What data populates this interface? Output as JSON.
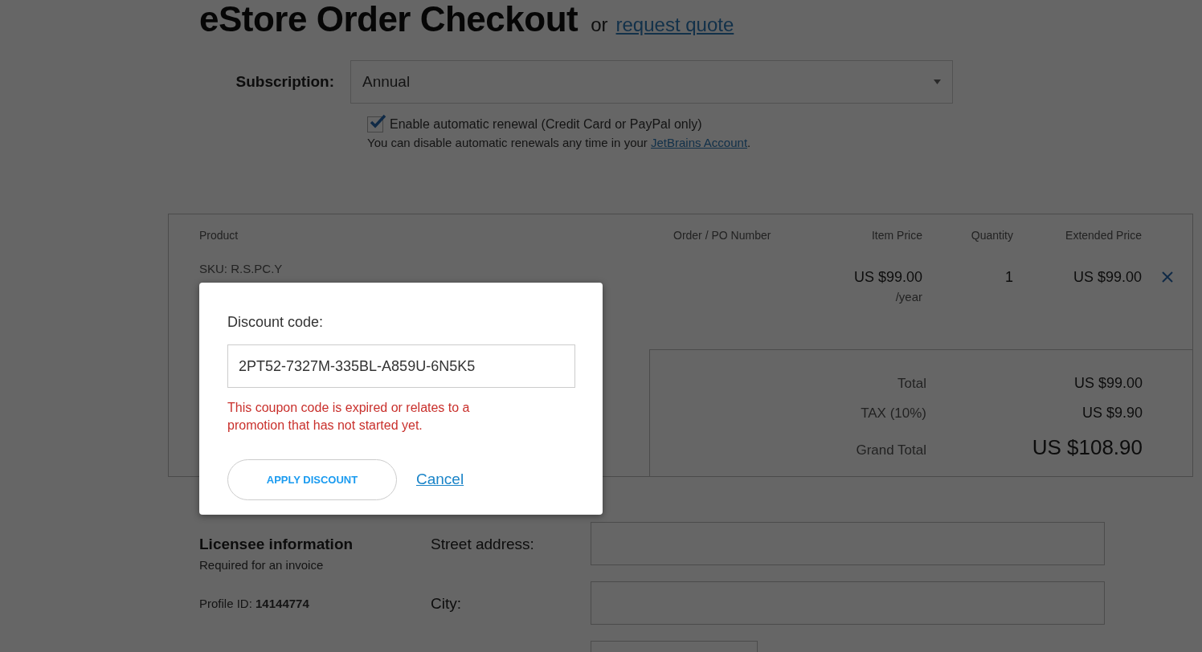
{
  "header": {
    "title": "eStore Order Checkout",
    "or_text": "or",
    "quote_link": "request quote"
  },
  "subscription": {
    "label": "Subscription:",
    "value": "Annual"
  },
  "auto_renewal": {
    "label": "Enable automatic renewal (Credit Card or PayPal only)",
    "checked": true,
    "note": "You can disable automatic renewals any time in your",
    "note_link": "JetBrains Account",
    "note_end": "."
  },
  "order_table": {
    "columns": [
      "Product",
      "Order / PO Number",
      "Item Price",
      "Quantity",
      "Extended Price"
    ],
    "rows": [
      {
        "sku": "SKU: R.S.PC.Y",
        "item_price": "US $99.00",
        "period": "/year",
        "quantity": "1",
        "extended_price": "US $99.00"
      }
    ]
  },
  "totals": [
    {
      "kind": "normal",
      "label": "Total",
      "value": "US $99.00"
    },
    {
      "kind": "normal",
      "label": "TAX (10%)",
      "value": "US $9.90"
    },
    {
      "kind": "grand",
      "label": "Grand Total",
      "value": "US $108.90"
    }
  ],
  "licensee": {
    "title": "Licensee information",
    "subtitle": "Required for an invoice",
    "profile": "Profile ID: **14144774**"
  },
  "address_fields": [
    {
      "kind": "wide",
      "label": "Street address:"
    },
    {
      "kind": "wide",
      "label": "City:"
    },
    {
      "kind": "short"
    }
  ],
  "modal": {
    "label": "Discount code:",
    "value": "2PT52-7327M-335BL-A859U-6N5K5",
    "error": "This coupon code is expired or relates to a promotion that has not started yet.",
    "apply_button": "APPLY DISCOUNT",
    "cancel_link": "Cancel"
  }
}
